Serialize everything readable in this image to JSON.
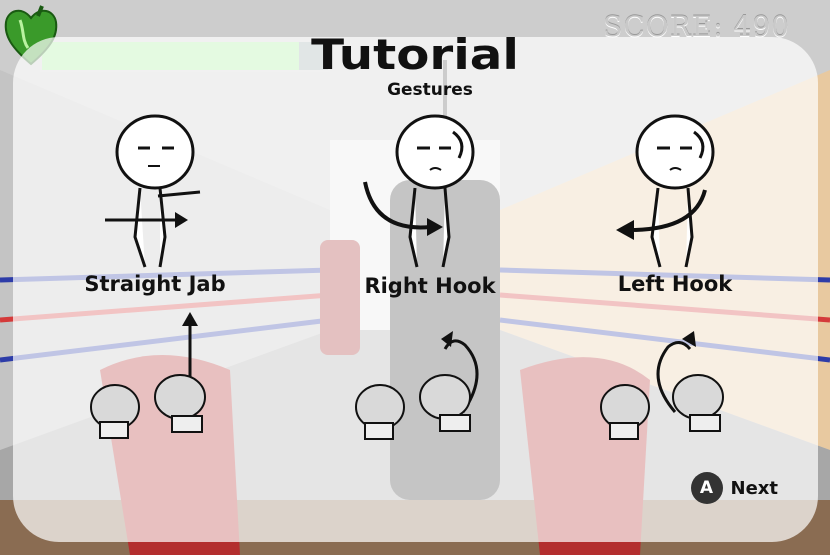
{
  "hud": {
    "score_text": "SCORE: 490",
    "health_fraction": 0.9
  },
  "tutorial": {
    "title": "Tutorial",
    "subtitle": "Gestures",
    "gestures": [
      {
        "label": "Straight Jab",
        "arrow": "straight-up"
      },
      {
        "label": "Right Hook",
        "arrow": "curve-right"
      },
      {
        "label": "Left Hook",
        "arrow": "curve-left"
      }
    ],
    "next": {
      "button_glyph": "A",
      "label": "Next"
    }
  },
  "colors": {
    "health": "#a4ef9b",
    "ring_red": "#d43a3a",
    "ring_blue": "#2d3ca8",
    "floor": "#8a6c52"
  },
  "icons": {
    "heart": "heart-icon",
    "glove": "boxing-glove-icon",
    "character": "stick-figure-icon"
  }
}
